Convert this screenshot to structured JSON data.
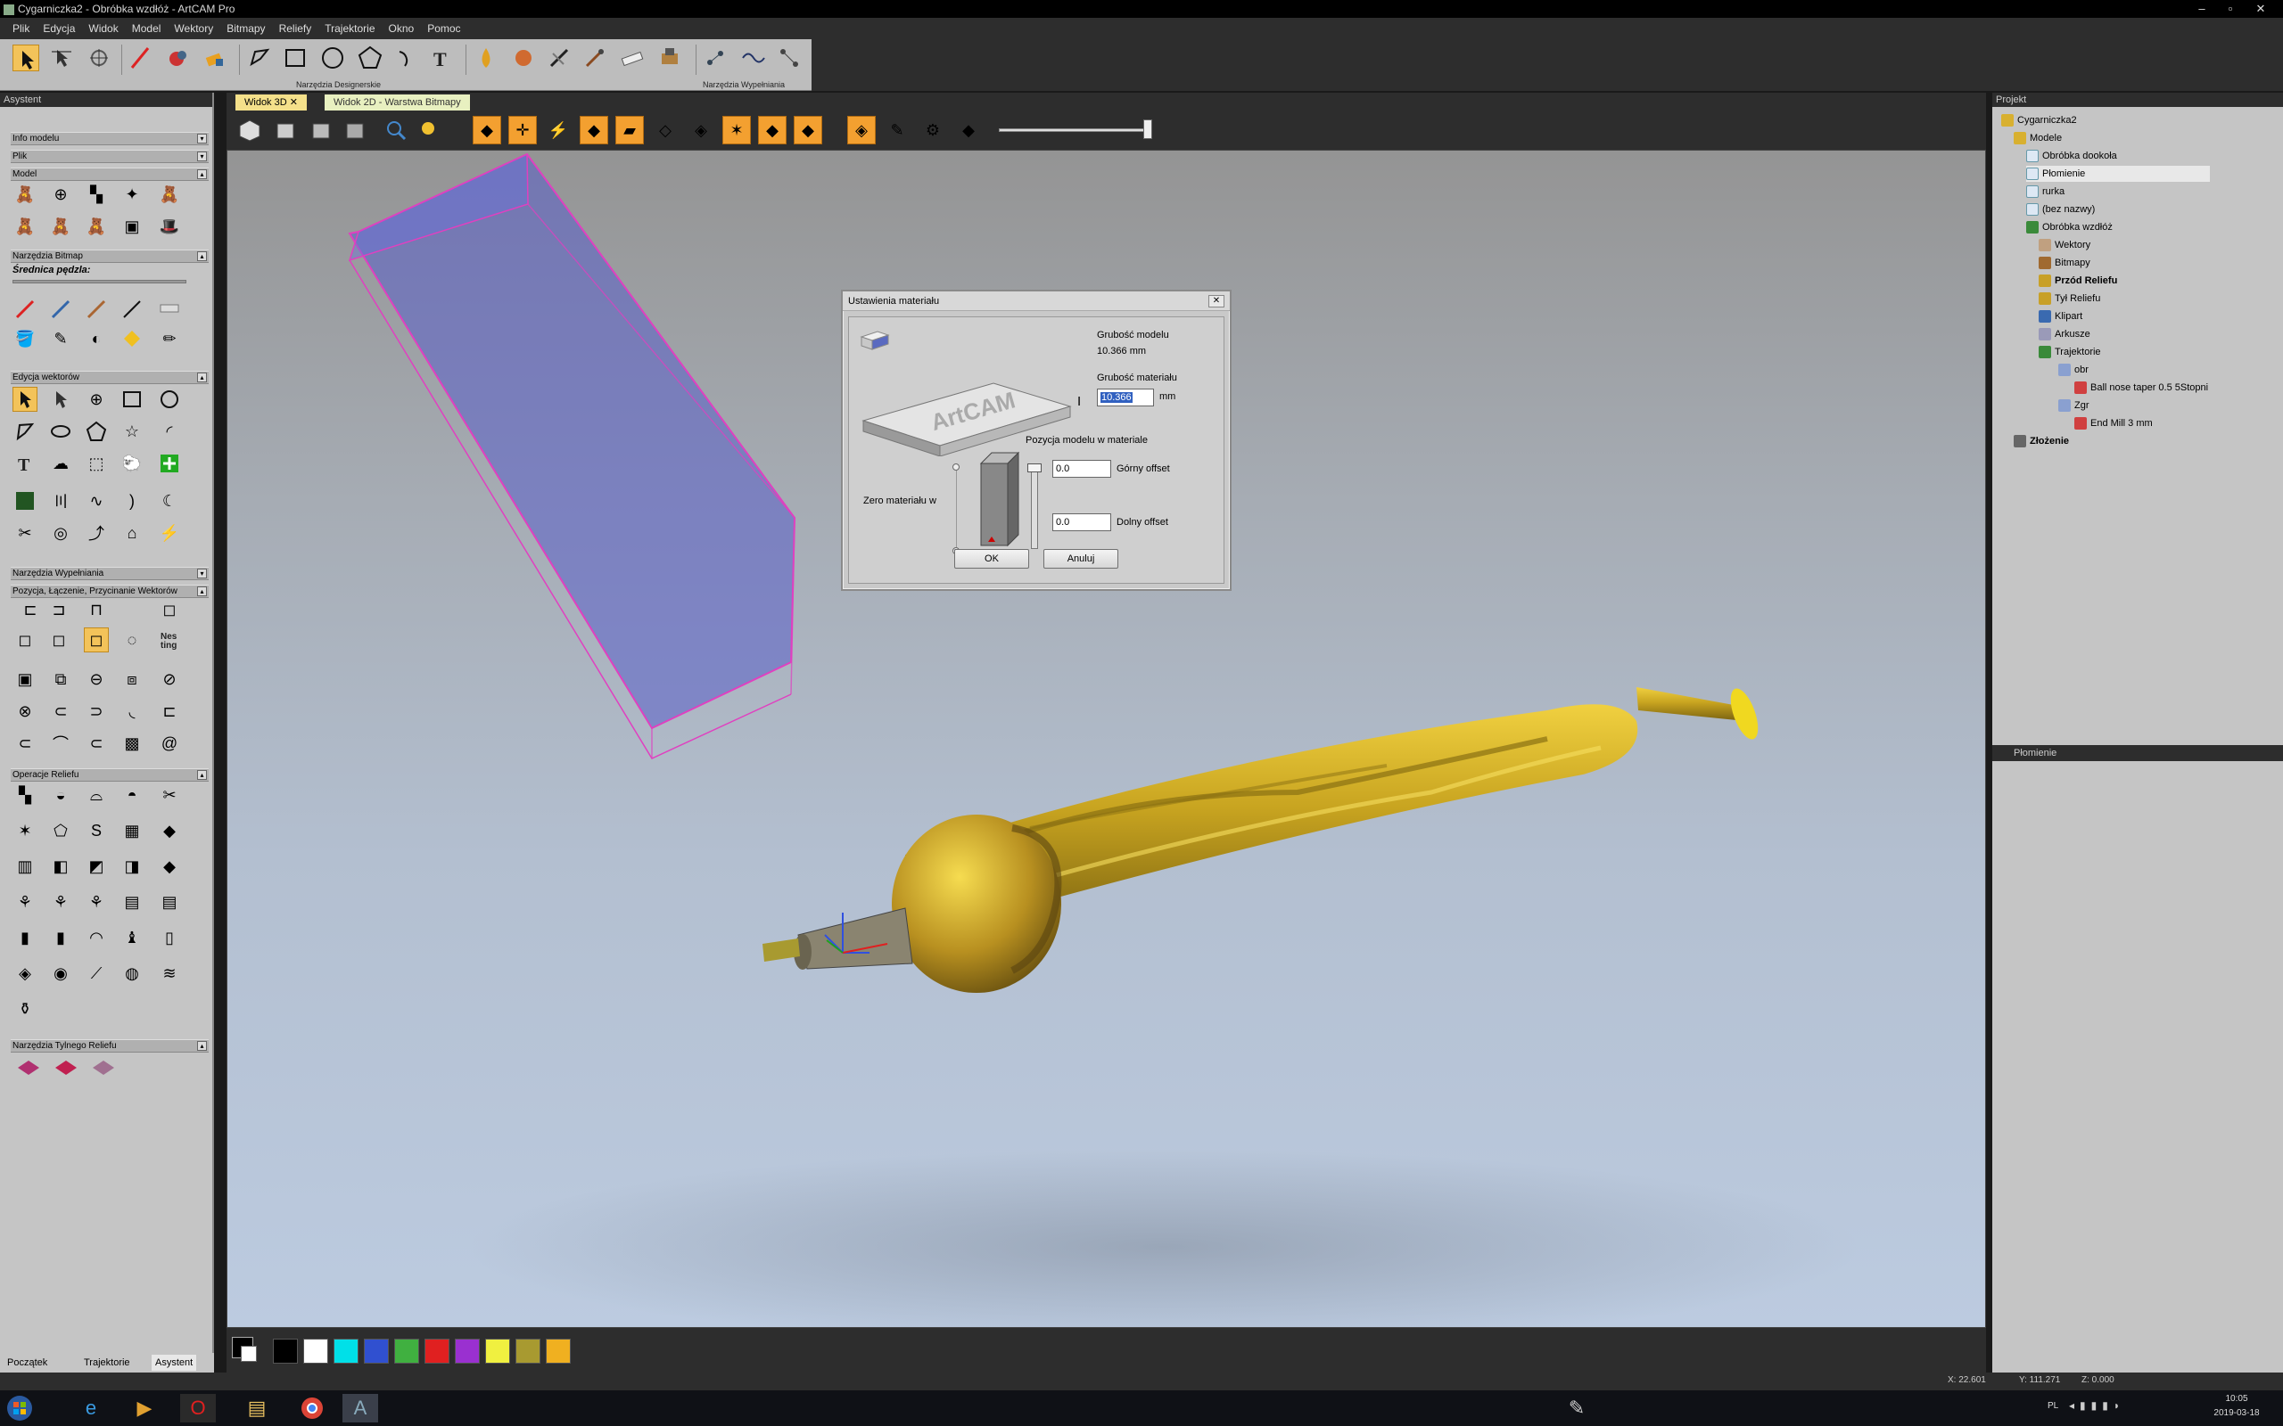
{
  "window": {
    "title": "Cygarniczka2 - Obróbka wzdłóż - ArtCAM Pro",
    "minimize": "–",
    "maximize": "▫",
    "close": "✕"
  },
  "menu": [
    "Plik",
    "Edycja",
    "Widok",
    "Model",
    "Wektory",
    "Bitmapy",
    "Reliefy",
    "Trajektorie",
    "Okno",
    "Pomoc"
  ],
  "toolbar": {
    "group1_label": "Narzędzia Designerskie",
    "group2_label": "Narzędzia Wypełniania"
  },
  "left_panel": {
    "title": "Asystent",
    "sections": {
      "info": "Info modelu",
      "file": "Plik",
      "model": "Model",
      "bitmap_tools": "Narzędzia Bitmap",
      "brush_diameter": "Średnica pędzla:",
      "vector_edit": "Edycja wektorów",
      "fill_tools": "Narzędzia Wypełniania",
      "position": "Pozycja, Łączenie, Przycinanie Wektorów",
      "relief_ops": "Operacje Reliefu",
      "back_relief": "Narzędzia Tylnego Reliefu"
    },
    "bottom_tabs": [
      "Początek",
      "Trajektorie",
      "Asystent"
    ]
  },
  "doc_tabs": {
    "tab1": "Widok 3D",
    "tab2": "Widok 2D - Warstwa Bitmapy"
  },
  "dialog": {
    "title": "Ustawienia materiału",
    "model_thickness_label": "Grubość modelu",
    "model_thickness_value": "10.366 mm",
    "material_thickness_label": "Grubość materiału",
    "material_thickness_value": "10.366",
    "unit": "mm",
    "position_label": "Pozycja modelu w materiale",
    "zero_label": "Zero materiału w",
    "top_offset_value": "0.0",
    "top_offset_label": "Górny offset",
    "bottom_offset_value": "0.0",
    "bottom_offset_label": "Dolny offset",
    "ok": "OK",
    "cancel": "Anuluj",
    "logo_text": "ArtCAM"
  },
  "project": {
    "title": "Projekt",
    "tree": [
      {
        "label": "Cygarniczka2",
        "level": 0,
        "bold": false
      },
      {
        "label": "Modele",
        "level": 1,
        "bold": false
      },
      {
        "label": "Obróbka dookoła",
        "level": 2,
        "bold": false
      },
      {
        "label": "Płomienie",
        "level": 2,
        "bold": false
      },
      {
        "label": "rurka",
        "level": 2,
        "bold": false
      },
      {
        "label": "(bez nazwy)",
        "level": 2,
        "bold": false
      },
      {
        "label": "Obróbka wzdłóż",
        "level": 2,
        "bold": false
      },
      {
        "label": "Wektory",
        "level": 3,
        "bold": false
      },
      {
        "label": "Bitmapy",
        "level": 3,
        "bold": false
      },
      {
        "label": "Przód Reliefu",
        "level": 3,
        "bold": true
      },
      {
        "label": "Tył Reliefu",
        "level": 3,
        "bold": false
      },
      {
        "label": "Klipart",
        "level": 3,
        "bold": false
      },
      {
        "label": "Arkusze",
        "level": 3,
        "bold": false
      },
      {
        "label": "Trajektorie",
        "level": 3,
        "bold": false
      },
      {
        "label": "obr",
        "level": 4,
        "bold": false
      },
      {
        "label": "Ball nose taper 0.5 5Stopni",
        "level": 5,
        "bold": false
      },
      {
        "label": "Zgr",
        "level": 4,
        "bold": false
      },
      {
        "label": "End Mill 3 mm",
        "level": 5,
        "bold": false
      },
      {
        "label": "Złożenie",
        "level": 1,
        "bold": true
      }
    ],
    "selected_item": "Płomienie"
  },
  "status": {
    "x": "X: 22.601",
    "y": "Y: 111.271",
    "z": "Z: 0.000"
  },
  "taskbar": {
    "lang": "PL",
    "time": "10:05",
    "date": "2019-03-18"
  },
  "palette_colors": [
    "#000000",
    "#ffffff",
    "#00e0e8",
    "#3050d0",
    "#40b040",
    "#e02020",
    "#9a30d0",
    "#f0f040",
    "#a89a30",
    "#f0b020"
  ],
  "colors": {
    "accent": "#f3c35a",
    "selection_box": "#e040c0",
    "model": "#c8a828"
  }
}
